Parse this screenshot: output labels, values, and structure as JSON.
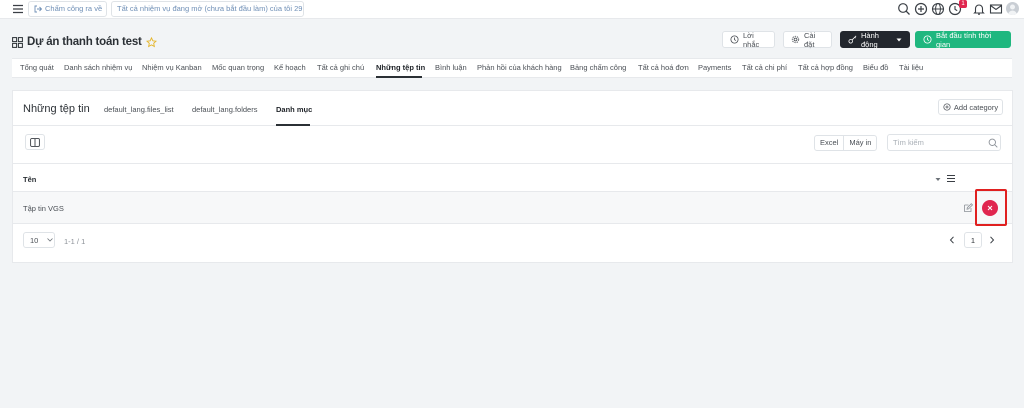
{
  "topbar": {
    "clockout_label": "Chấm công ra về",
    "tasks_pill_label": "Tất cả nhiệm vụ đang mở (chưa bắt đầu làm) của tôi",
    "tasks_pill_count": "29",
    "notification_count": "1",
    "icons": [
      "menu-icon",
      "search-icon",
      "plus-circle-icon",
      "globe-icon",
      "clock-icon",
      "bell-icon",
      "mail-icon",
      "avatar"
    ]
  },
  "project": {
    "title": "Dự án thanh toán test",
    "reminder_label": "Lời nhắc",
    "settings_label": "Cài đặt",
    "actions_label": "Hành động",
    "start_timer_label": "Bắt đầu tính thời gian"
  },
  "tabs": [
    {
      "label": "Tổng quát"
    },
    {
      "label": "Danh sách nhiệm vụ"
    },
    {
      "label": "Nhiệm vụ Kanban"
    },
    {
      "label": "Mốc quan trọng"
    },
    {
      "label": "Kế hoạch"
    },
    {
      "label": "Tất cả ghi chú"
    },
    {
      "label": "Những tệp tin",
      "active": true
    },
    {
      "label": "Bình luận"
    },
    {
      "label": "Phản hồi của khách hàng"
    },
    {
      "label": "Bảng chấm công"
    },
    {
      "label": "Tất cả hoá đơn"
    },
    {
      "label": "Payments"
    },
    {
      "label": "Tất cả chi phí"
    },
    {
      "label": "Tất cả hợp đồng"
    },
    {
      "label": "Biểu đồ"
    },
    {
      "label": "Tài liệu"
    }
  ],
  "panel": {
    "title": "Những tệp tin",
    "sub_tabs": [
      "default_lang.files_list",
      "default_lang.folders",
      "Danh mục"
    ],
    "active_sub_tab": "Danh mục",
    "add_category_label": "Add category",
    "export_buttons": [
      "Excel",
      "Máy in"
    ],
    "search": {
      "placeholder": "Tìm kiếm",
      "value": ""
    },
    "table": {
      "columns": [
        "Tên"
      ],
      "rows": [
        {
          "name": "Tập tin VGS"
        }
      ]
    },
    "pagination": {
      "page_size": "10",
      "range_text": "1-1 / 1",
      "current_page": "1"
    }
  },
  "colors": {
    "accent_green": "#1fb77f",
    "dark_button": "#23272e",
    "delete_red": "#e0264f",
    "highlight_box": "#e02020",
    "link_blue": "#6f8fb6"
  }
}
